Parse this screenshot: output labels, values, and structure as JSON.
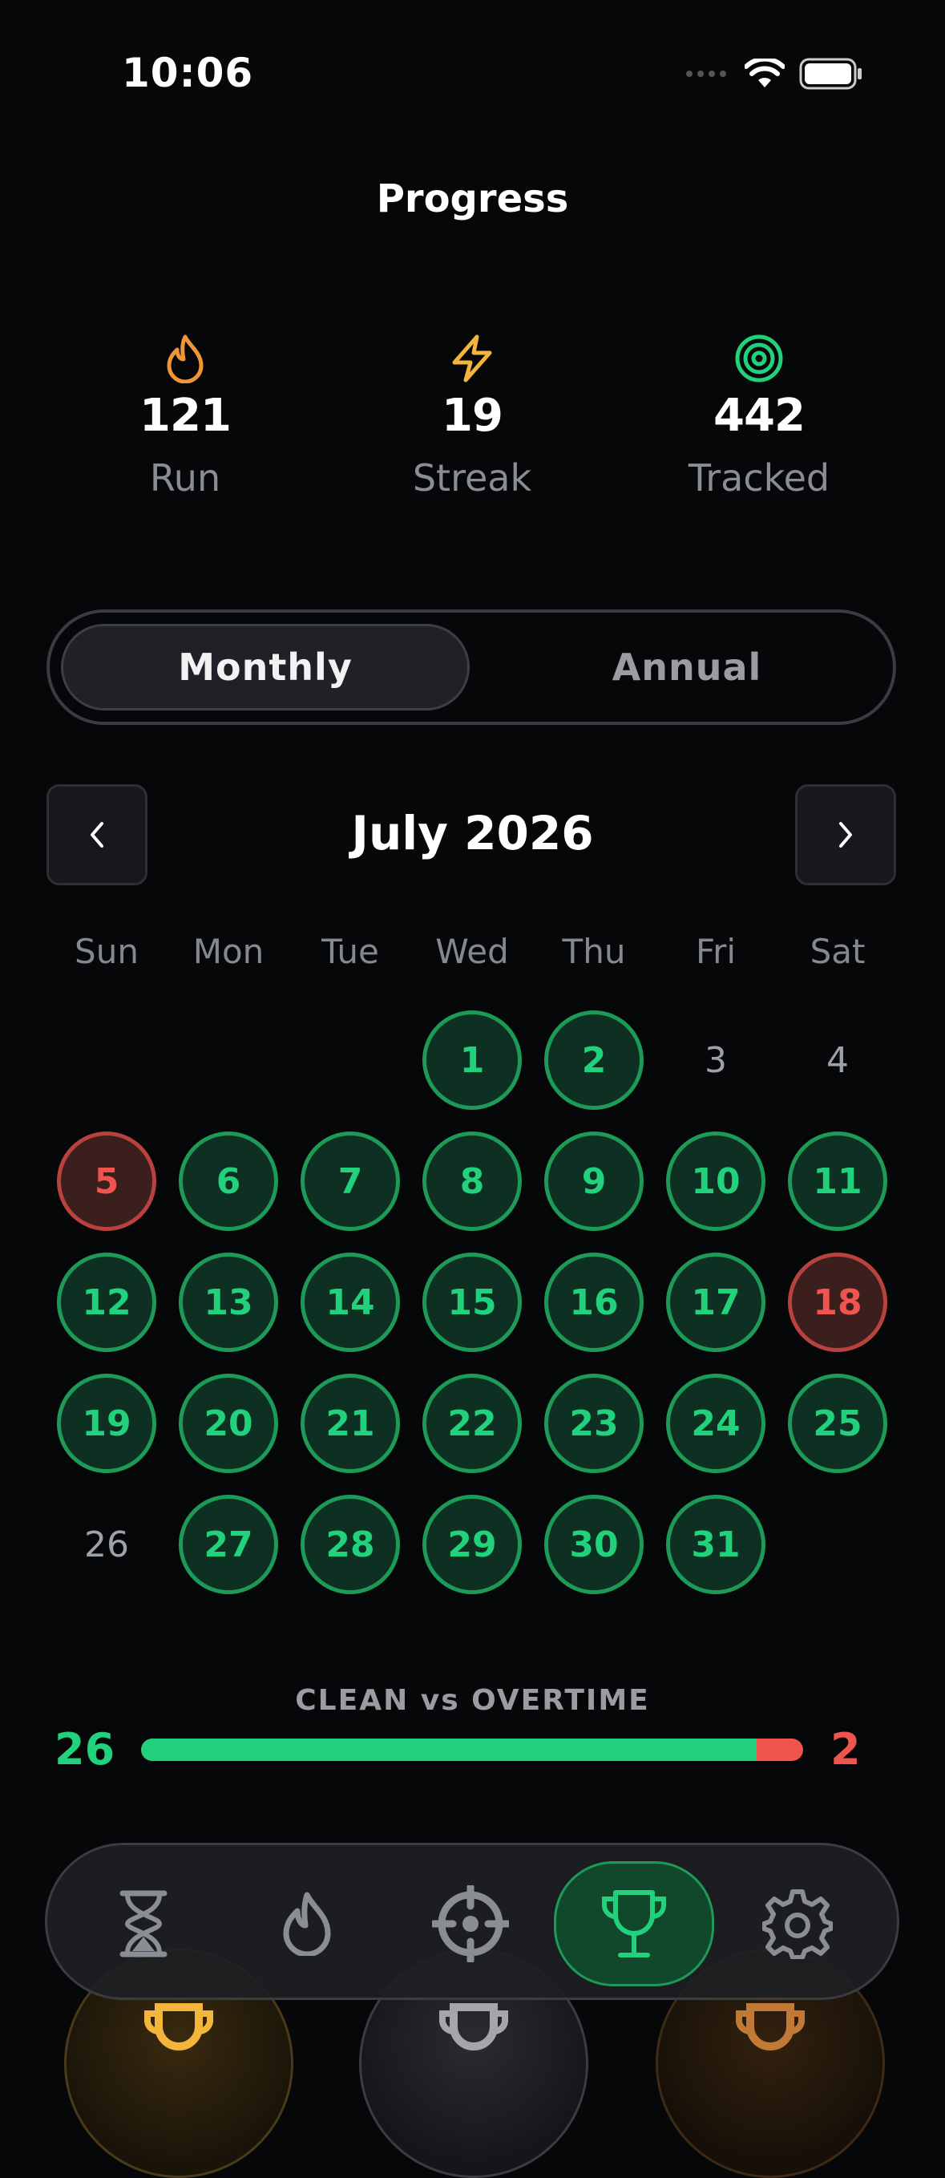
{
  "status": {
    "time": "10:06"
  },
  "title": "Progress",
  "stats": [
    {
      "icon": "flame-icon",
      "value": "121",
      "label": "Run",
      "color": "#f0953a"
    },
    {
      "icon": "bolt-icon",
      "value": "19",
      "label": "Streak",
      "color": "#f3b53b"
    },
    {
      "icon": "target-icon",
      "value": "442",
      "label": "Tracked",
      "color": "#22d17c"
    }
  ],
  "segmented": {
    "options": [
      "Monthly",
      "Annual"
    ],
    "selected": "Monthly"
  },
  "calendar": {
    "month_label": "July 2026",
    "weekdays": [
      "Sun",
      "Mon",
      "Tue",
      "Wed",
      "Thu",
      "Fri",
      "Sat"
    ],
    "first_weekday_index": 3,
    "days": [
      {
        "n": "1",
        "s": "clean"
      },
      {
        "n": "2",
        "s": "clean"
      },
      {
        "n": "3",
        "s": "none"
      },
      {
        "n": "4",
        "s": "none"
      },
      {
        "n": "5",
        "s": "over"
      },
      {
        "n": "6",
        "s": "clean"
      },
      {
        "n": "7",
        "s": "clean"
      },
      {
        "n": "8",
        "s": "clean"
      },
      {
        "n": "9",
        "s": "clean"
      },
      {
        "n": "10",
        "s": "clean"
      },
      {
        "n": "11",
        "s": "clean"
      },
      {
        "n": "12",
        "s": "clean"
      },
      {
        "n": "13",
        "s": "clean"
      },
      {
        "n": "14",
        "s": "clean"
      },
      {
        "n": "15",
        "s": "clean"
      },
      {
        "n": "16",
        "s": "clean"
      },
      {
        "n": "17",
        "s": "clean"
      },
      {
        "n": "18",
        "s": "over"
      },
      {
        "n": "19",
        "s": "clean"
      },
      {
        "n": "20",
        "s": "clean"
      },
      {
        "n": "21",
        "s": "clean"
      },
      {
        "n": "22",
        "s": "clean"
      },
      {
        "n": "23",
        "s": "clean"
      },
      {
        "n": "24",
        "s": "clean"
      },
      {
        "n": "25",
        "s": "clean"
      },
      {
        "n": "26",
        "s": "none"
      },
      {
        "n": "27",
        "s": "clean"
      },
      {
        "n": "28",
        "s": "clean"
      },
      {
        "n": "29",
        "s": "clean"
      },
      {
        "n": "30",
        "s": "clean"
      },
      {
        "n": "31",
        "s": "clean"
      }
    ]
  },
  "clean_vs_overtime": {
    "label": "CLEAN vs OVERTIME",
    "clean": "26",
    "overtime": "2",
    "clean_fraction": 0.93
  },
  "tabbar": {
    "tabs": [
      {
        "icon": "hourglass-icon"
      },
      {
        "icon": "flame-icon"
      },
      {
        "icon": "crosshair-icon"
      },
      {
        "icon": "trophy-icon",
        "active": true
      },
      {
        "icon": "gear-icon"
      }
    ]
  },
  "colors": {
    "clean": "#22d17c",
    "overtime": "#f0544f",
    "accent_bg": "#11472a"
  }
}
